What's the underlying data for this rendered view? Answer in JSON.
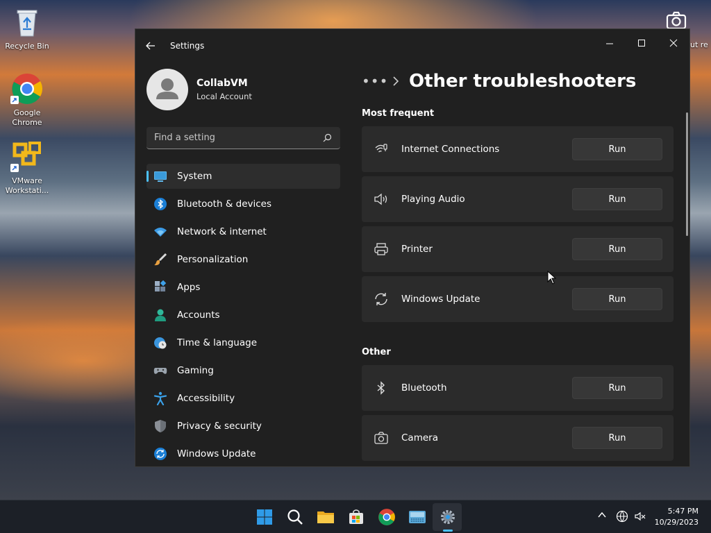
{
  "desktop": {
    "icons": [
      {
        "label": "Recycle Bin"
      },
      {
        "label": "Google Chrome"
      },
      {
        "label": "VMware Workstati..."
      }
    ],
    "right_label": "ut re"
  },
  "window": {
    "title": "Settings",
    "profile": {
      "name": "CollabVM",
      "account_type": "Local Account"
    },
    "search": {
      "placeholder": "Find a setting"
    },
    "nav": [
      {
        "label": "System",
        "icon": "system-icon",
        "active": true
      },
      {
        "label": "Bluetooth & devices",
        "icon": "bluetooth-icon"
      },
      {
        "label": "Network & internet",
        "icon": "network-icon"
      },
      {
        "label": "Personalization",
        "icon": "brush-icon"
      },
      {
        "label": "Apps",
        "icon": "apps-icon"
      },
      {
        "label": "Accounts",
        "icon": "accounts-icon"
      },
      {
        "label": "Time & language",
        "icon": "globe-clock-icon"
      },
      {
        "label": "Gaming",
        "icon": "gamepad-icon"
      },
      {
        "label": "Accessibility",
        "icon": "accessibility-icon"
      },
      {
        "label": "Privacy & security",
        "icon": "shield-icon"
      },
      {
        "label": "Windows Update",
        "icon": "update-icon"
      }
    ],
    "breadcrumb": {
      "more": "•••",
      "title": "Other troubleshooters"
    },
    "sections": [
      {
        "heading": "Most frequent",
        "items": [
          {
            "label": "Internet Connections",
            "icon": "wifi-icon",
            "button": "Run"
          },
          {
            "label": "Playing Audio",
            "icon": "speaker-icon",
            "button": "Run"
          },
          {
            "label": "Printer",
            "icon": "printer-icon",
            "button": "Run"
          },
          {
            "label": "Windows Update",
            "icon": "sync-icon",
            "button": "Run"
          }
        ]
      },
      {
        "heading": "Other",
        "items": [
          {
            "label": "Bluetooth",
            "icon": "bluetooth-icon",
            "button": "Run"
          },
          {
            "label": "Camera",
            "icon": "camera-icon",
            "button": "Run"
          }
        ]
      }
    ]
  },
  "taskbar": {
    "apps": [
      "start-icon",
      "search-icon",
      "file-explorer-icon",
      "store-icon",
      "chrome-icon",
      "keyboard-app-icon",
      "settings-icon"
    ],
    "clock": {
      "time": "5:47 PM",
      "date": "10/29/2023"
    }
  },
  "colors": {
    "accent": "#4cc2ff",
    "window_bg": "#202020",
    "card_bg": "#2b2b2b"
  }
}
